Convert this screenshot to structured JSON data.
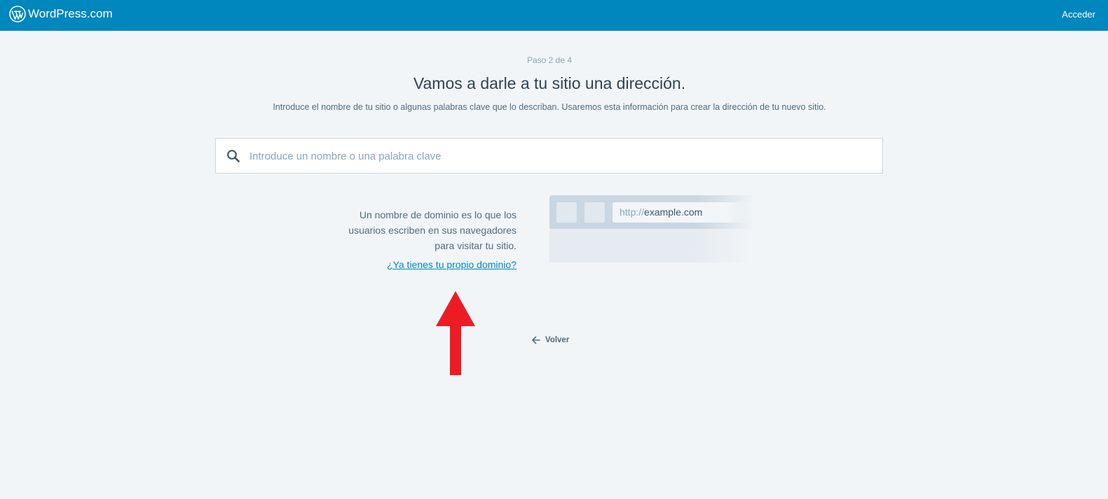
{
  "masthead": {
    "brand": "WordPress.com",
    "login_label": "Acceder"
  },
  "step": {
    "label": "Paso 2 de 4"
  },
  "header": {
    "title": "Vamos a darle a tu sitio una dirección.",
    "subtitle": "Introduce el nombre de tu sitio o algunas palabras clave que lo describan. Usaremos esta información para crear la dirección de tu nuevo sitio."
  },
  "search": {
    "placeholder": "Introduce un nombre o una palabra clave",
    "value": "",
    "icon": "search-icon"
  },
  "info": {
    "line1": "Un nombre de dominio es lo que los",
    "line2": "usuarios escriben en sus navegadores",
    "line3": "para visitar tu sitio.",
    "link_label": "¿Ya tienes tu propio dominio?"
  },
  "illustration": {
    "protocol": "http://",
    "host": "example.com"
  },
  "footer": {
    "back_label": "Volver",
    "back_icon": "arrow-left-icon"
  },
  "colors": {
    "masthead": "#0087be",
    "background": "#f2f5f8",
    "link": "#0087be",
    "annotation_arrow": "#ed1c24"
  }
}
